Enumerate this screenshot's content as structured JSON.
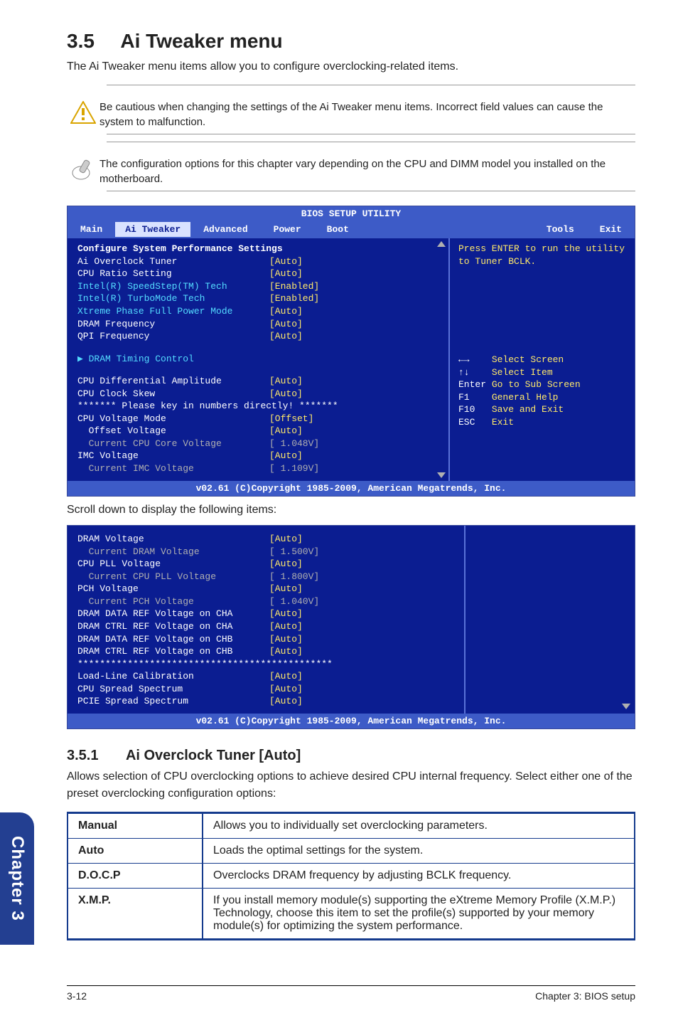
{
  "header": {
    "num": "3.5",
    "title": "Ai Tweaker menu"
  },
  "intro": "The Ai Tweaker menu items allow you to configure overclocking-related items.",
  "callout_warn": "Be cautious when changing the settings of the Ai Tweaker menu items. Incorrect field values can cause the system to malfunction.",
  "callout_note": "The configuration options for this chapter vary depending on the CPU and DIMM model you installed on the motherboard.",
  "bios": {
    "title": "BIOS SETUP UTILITY",
    "tabs": [
      "Main",
      "Ai Tweaker",
      "Advanced",
      "Power",
      "Boot",
      "Tools",
      "Exit"
    ],
    "selected_tab": "Ai Tweaker",
    "heading": "Configure System Performance Settings",
    "rows": [
      {
        "label": "Ai Overclock Tuner",
        "value": "[Auto]",
        "labelClass": "label-w",
        "valClass": "val-y"
      },
      {
        "label": "CPU Ratio Setting",
        "value": "[Auto]",
        "labelClass": "label-w",
        "valClass": "val-y"
      },
      {
        "label": "Intel(R) SpeedStep(TM) Tech",
        "value": "[Enabled]",
        "labelClass": "label-c",
        "valClass": "val-y"
      },
      {
        "label": "Intel(R) TurboMode Tech",
        "value": "[Enabled]",
        "labelClass": "label-c",
        "valClass": "val-y"
      },
      {
        "label": "Xtreme Phase Full Power Mode",
        "value": "[Auto]",
        "labelClass": "label-c",
        "valClass": "val-y"
      },
      {
        "label": "DRAM Frequency",
        "value": "[Auto]",
        "labelClass": "label-w",
        "valClass": "val-y"
      },
      {
        "label": "QPI Frequency",
        "value": "[Auto]",
        "labelClass": "label-w",
        "valClass": "val-y"
      },
      {
        "spacer": true
      },
      {
        "label": "▶ DRAM Timing Control",
        "value": "",
        "labelClass": "label-c",
        "valClass": ""
      },
      {
        "spacer": true
      },
      {
        "label": "CPU Differential Amplitude",
        "value": "[Auto]",
        "labelClass": "label-w",
        "valClass": "val-y"
      },
      {
        "label": "CPU Clock Skew",
        "value": "[Auto]",
        "labelClass": "label-w",
        "valClass": "val-y"
      },
      {
        "label": "******* Please key in numbers directly! *******",
        "value": "",
        "labelClass": "label-w full",
        "valClass": ""
      },
      {
        "label": "CPU Voltage Mode",
        "value": "[Offset]",
        "labelClass": "label-w",
        "valClass": "val-y"
      },
      {
        "label": "  Offset Voltage",
        "value": "[Auto]",
        "labelClass": "label-w",
        "valClass": "val-y"
      },
      {
        "label": "  Current CPU Core Voltage",
        "value": "[ 1.048V]",
        "labelClass": "hl-g",
        "valClass": "hl-g"
      },
      {
        "label": "IMC Voltage",
        "value": "[Auto]",
        "labelClass": "label-w",
        "valClass": "val-y"
      },
      {
        "label": "  Current IMC Voltage",
        "value": "[ 1.109V]",
        "labelClass": "hl-g",
        "valClass": "hl-g"
      }
    ],
    "help": "Press ENTER to run the utility to Tuner BCLK.",
    "nav": [
      {
        "k": "←→",
        "v": "Select Screen"
      },
      {
        "k": "↑↓",
        "v": "Select Item"
      },
      {
        "k": "Enter",
        "v": "Go to Sub Screen"
      },
      {
        "k": "F1",
        "v": "General Help"
      },
      {
        "k": "F10",
        "v": "Save and Exit"
      },
      {
        "k": "ESC",
        "v": "Exit"
      }
    ],
    "footer": "v02.61 (C)Copyright 1985-2009, American Megatrends, Inc."
  },
  "scroll_note": "Scroll down to display the following items:",
  "bios2": {
    "rows": [
      {
        "label": "DRAM Voltage",
        "value": "[Auto]",
        "labelClass": "label-w",
        "valClass": "val-y"
      },
      {
        "label": "  Current DRAM Voltage",
        "value": "[ 1.500V]",
        "labelClass": "hl-g",
        "valClass": "hl-g"
      },
      {
        "label": "CPU PLL Voltage",
        "value": "[Auto]",
        "labelClass": "label-w",
        "valClass": "val-y"
      },
      {
        "label": "  Current CPU PLL Voltage",
        "value": "[ 1.800V]",
        "labelClass": "hl-g",
        "valClass": "hl-g"
      },
      {
        "label": "PCH Voltage",
        "value": "[Auto]",
        "labelClass": "label-w",
        "valClass": "val-y"
      },
      {
        "label": "  Current PCH Voltage",
        "value": "[ 1.040V]",
        "labelClass": "hl-g",
        "valClass": "hl-g"
      },
      {
        "label": "DRAM DATA REF Voltage on CHA",
        "value": "[Auto]",
        "labelClass": "label-w",
        "valClass": "val-y"
      },
      {
        "label": "DRAM CTRL REF Voltage on CHA",
        "value": "[Auto]",
        "labelClass": "label-w",
        "valClass": "val-y"
      },
      {
        "label": "DRAM DATA REF Voltage on CHB",
        "value": "[Auto]",
        "labelClass": "label-w",
        "valClass": "val-y"
      },
      {
        "label": "DRAM CTRL REF Voltage on CHB",
        "value": "[Auto]",
        "labelClass": "label-w",
        "valClass": "val-y"
      },
      {
        "label": "**********************************************",
        "value": "",
        "labelClass": "label-w",
        "valClass": ""
      },
      {
        "label": "Load-Line Calibration",
        "value": "[Auto]",
        "labelClass": "label-w",
        "valClass": "val-y"
      },
      {
        "label": "CPU Spread Spectrum",
        "value": "[Auto]",
        "labelClass": "label-w",
        "valClass": "val-y"
      },
      {
        "label": "PCIE Spread Spectrum",
        "value": "[Auto]",
        "labelClass": "label-w",
        "valClass": "val-y"
      }
    ],
    "footer": "v02.61 (C)Copyright 1985-2009, American Megatrends, Inc."
  },
  "section": {
    "num": "3.5.1",
    "title": "Ai Overclock Tuner [Auto]"
  },
  "section_desc": "Allows selection of CPU overclocking options to achieve desired CPU internal frequency. Select either one of the preset overclocking configuration options:",
  "options": [
    {
      "name": "Manual",
      "desc": "Allows you to individually set overclocking parameters."
    },
    {
      "name": "Auto",
      "desc": "Loads the optimal settings for the system."
    },
    {
      "name": "D.O.C.P",
      "desc": "Overclocks DRAM frequency by adjusting BCLK frequency."
    },
    {
      "name": "X.M.P.",
      "desc": "If you install memory module(s) supporting the eXtreme Memory Profile (X.M.P.) Technology, choose this item to set the profile(s) supported by your memory module(s) for optimizing the system performance."
    }
  ],
  "sidetab": "Chapter 3",
  "footer_left": "3-12",
  "footer_right": "Chapter 3: BIOS setup"
}
